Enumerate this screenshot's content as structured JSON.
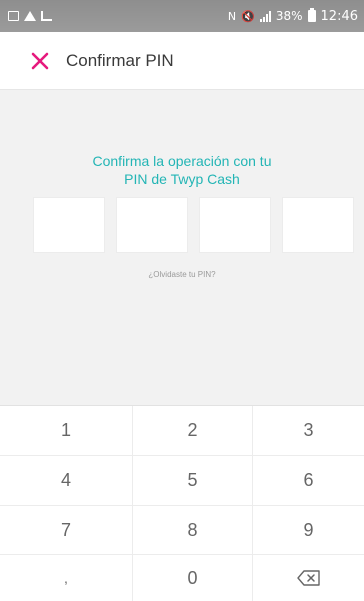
{
  "status_bar": {
    "battery_percent": "38%",
    "time": "12:46"
  },
  "appbar": {
    "title": "Confirmar PIN",
    "close_icon": "close-icon"
  },
  "pin": {
    "prompt_line1": "Confirma la operación con tu",
    "prompt_line2": "PIN de Twyp Cash",
    "digits": 4,
    "forgot_link": "¿Olvidaste tu PIN?"
  },
  "keypad": {
    "keys": [
      "1",
      "2",
      "3",
      "4",
      "5",
      "6",
      "7",
      "8",
      "9",
      ",",
      "0"
    ],
    "backspace_icon": "backspace-icon"
  },
  "colors": {
    "accent": "#e6197d",
    "prompt_text": "#23b5b5",
    "background": "#f2f2f2"
  }
}
